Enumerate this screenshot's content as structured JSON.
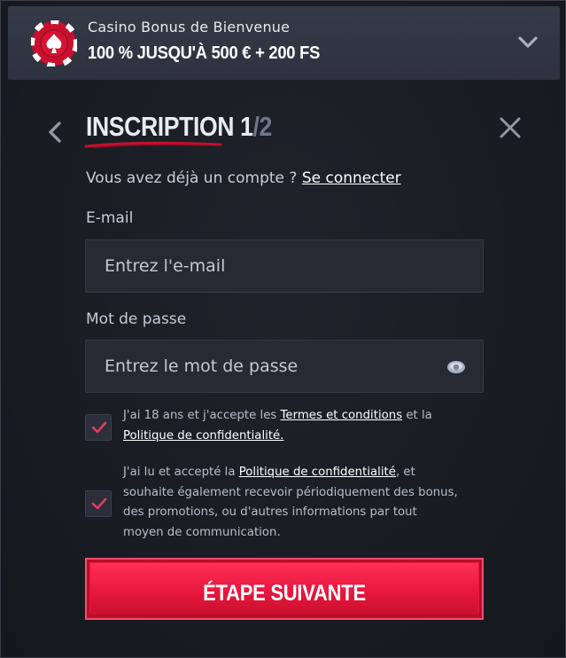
{
  "banner": {
    "subtitle": "Casino Bonus de Bienvenue",
    "title": "100 % JUSQU'À 500 € + 200 FS",
    "icon": "poker-chip-icon",
    "expand_icon": "chevron-down-icon"
  },
  "header": {
    "title": "INSCRIPTION",
    "step_current": "1",
    "step_total": "/2",
    "back_icon": "chevron-left-icon",
    "close_icon": "close-icon"
  },
  "login": {
    "prompt": "Vous avez déjà un compte ?",
    "link": "Se connecter"
  },
  "form": {
    "email_label": "E-mail",
    "email_placeholder": "Entrez l'e-mail",
    "email_value": "",
    "password_label": "Mot de passe",
    "password_placeholder": "Entrez le mot de passe",
    "password_value": "",
    "password_toggle_icon": "eye-icon"
  },
  "consents": [
    {
      "checked": true,
      "text_before": "J'ai 18 ans et j'accepte les ",
      "link1": "Termes et conditions",
      "text_middle": " et la ",
      "link2": "Politique de confidentialité.",
      "text_after": ""
    },
    {
      "checked": true,
      "text_before": "J'ai lu et accepté la ",
      "link1": "Politique de confidentialité",
      "text_after": ", et souhaite également recevoir périodiquement des bonus, des promotions, ou d'autres informations par tout moyen de communication."
    }
  ],
  "submit": {
    "label": "ÉTAPE SUIVANTE"
  },
  "colors": {
    "background": "#1a1d24",
    "banner": "#313744",
    "accent_red": "#e8173f",
    "check_mark": "#e83a5e",
    "input_bg": "#252a33"
  }
}
